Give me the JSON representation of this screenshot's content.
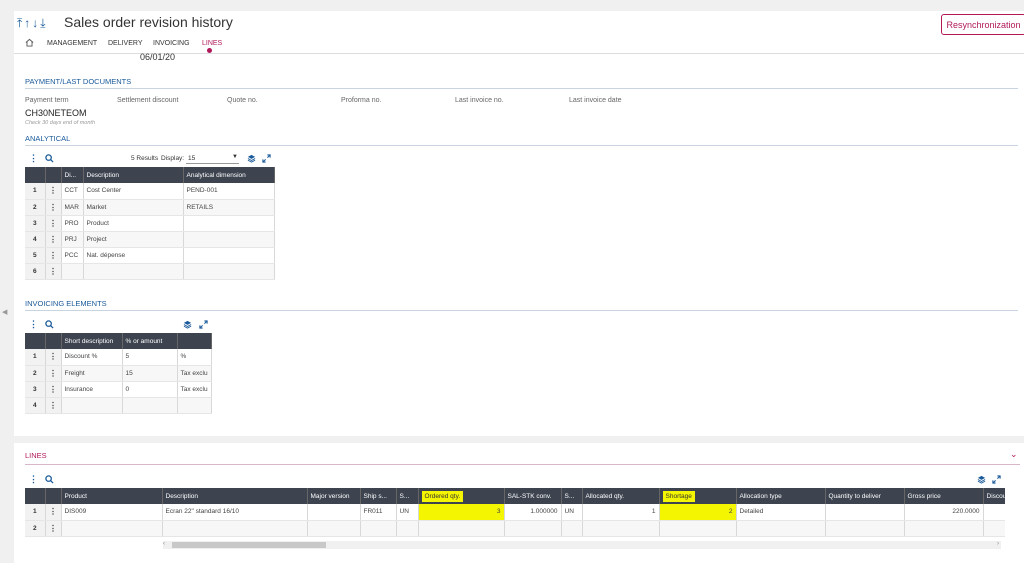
{
  "header": {
    "arrows": "⤒↑↓⤓",
    "title": "Sales order revision history",
    "resync_label": "Resynchronization",
    "tabs": [
      "MANAGEMENT",
      "DELIVERY",
      "INVOICING",
      "LINES"
    ],
    "active_tab": "LINES"
  },
  "top_date": "06/01/20",
  "payment": {
    "title": "PAYMENT/LAST DOCUMENTS",
    "labels": [
      "Payment term",
      "Settlement discount",
      "Quote no.",
      "Proforma no.",
      "Last invoice no.",
      "Last invoice date"
    ],
    "payment_term_value": "CH30NETEOM",
    "payment_term_hint": "Check 30 days end of month"
  },
  "analytical": {
    "title": "ANALYTICAL",
    "results": "5 Results",
    "display_label": "Display:",
    "display_value": "15",
    "columns": [
      "Di...",
      "Description",
      "Analytical dimension"
    ],
    "rows": [
      {
        "n": "1",
        "dim": "CCT",
        "desc": "Cost Center",
        "val": "PEND-001"
      },
      {
        "n": "2",
        "dim": "MAR",
        "desc": "Market",
        "val": "RETAILS"
      },
      {
        "n": "3",
        "dim": "PRO",
        "desc": "Product",
        "val": ""
      },
      {
        "n": "4",
        "dim": "PRJ",
        "desc": "Project",
        "val": ""
      },
      {
        "n": "5",
        "dim": "PCC",
        "desc": "Nat. dépense",
        "val": ""
      },
      {
        "n": "6",
        "dim": "",
        "desc": "",
        "val": ""
      }
    ]
  },
  "invoicing": {
    "title": "INVOICING ELEMENTS",
    "columns": [
      "Short description",
      "% or amount",
      ""
    ],
    "rows": [
      {
        "n": "1",
        "desc": "Discount %",
        "amt": "5",
        "unit": "%"
      },
      {
        "n": "2",
        "desc": "Freight",
        "amt": "15",
        "unit": "Tax exclu"
      },
      {
        "n": "3",
        "desc": "Insurance",
        "amt": "0",
        "unit": "Tax exclu"
      },
      {
        "n": "4",
        "desc": "",
        "amt": "",
        "unit": ""
      }
    ]
  },
  "lines": {
    "title": "LINES",
    "columns": [
      "Product",
      "Description",
      "Major version",
      "Ship s...",
      "S...",
      "Ordered qty.",
      "SAL-STK conv.",
      "S...",
      "Allocated qty.",
      "Shortage",
      "Allocation type",
      "Quantity to deliver",
      "Gross price",
      "Discou"
    ],
    "rows": [
      {
        "n": "1",
        "cells": [
          "DIS009",
          "Ecran 22\" standard 16/10",
          "",
          "FR011",
          "UN",
          "3",
          "1.000000",
          "UN",
          "1",
          "2",
          "Detailed",
          "",
          "220.0000",
          ""
        ]
      },
      {
        "n": "2",
        "cells": [
          "",
          "",
          "",
          "",
          "",
          "",
          "",
          "",
          "",
          "",
          "",
          "",
          "",
          ""
        ]
      }
    ]
  },
  "colors": {
    "accent": "#b0185a",
    "link": "#1a5a9a",
    "grid_header": "#3d4450",
    "highlight": "#f4f500"
  }
}
